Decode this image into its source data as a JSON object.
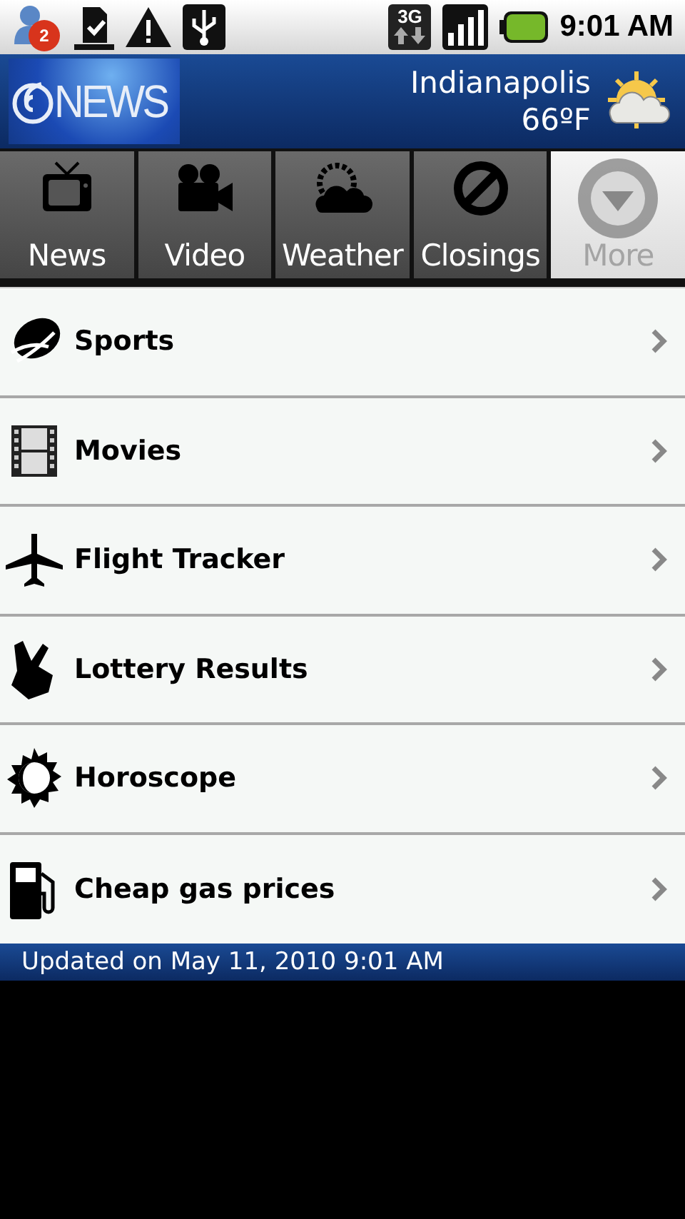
{
  "status_bar": {
    "notification_count": "2",
    "time": "9:01 AM",
    "network": "3G"
  },
  "header": {
    "logo": "NEWS",
    "city": "Indianapolis",
    "temperature": "66ºF"
  },
  "tabs": [
    {
      "label": "News",
      "selected": false
    },
    {
      "label": "Video",
      "selected": false
    },
    {
      "label": "Weather",
      "selected": false
    },
    {
      "label": "Closings",
      "selected": false
    },
    {
      "label": "More",
      "selected": true
    }
  ],
  "menu": [
    {
      "label": "Sports"
    },
    {
      "label": "Movies"
    },
    {
      "label": "Flight Tracker"
    },
    {
      "label": "Lottery Results"
    },
    {
      "label": "Horoscope"
    },
    {
      "label": "Cheap gas prices"
    }
  ],
  "footer": {
    "text": "Updated on May 11, 2010 9:01 AM"
  }
}
